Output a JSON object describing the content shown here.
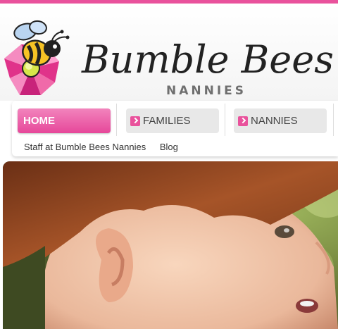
{
  "brand": {
    "name": "Bumble Bees",
    "subtitle": "NANNIES"
  },
  "nav": {
    "items": [
      {
        "label": "HOME",
        "active": true
      },
      {
        "label": "FAMILIES",
        "active": false
      },
      {
        "label": "NANNIES",
        "active": false
      }
    ],
    "sub_links": [
      "Staff at Bumble Bees Nannies",
      "Blog"
    ]
  },
  "colors": {
    "accent": "#e9529c",
    "text_dark": "#222222"
  },
  "icons": {
    "logo": "bee-on-flower-icon",
    "nav_arrow": "chevron-right-icon"
  }
}
